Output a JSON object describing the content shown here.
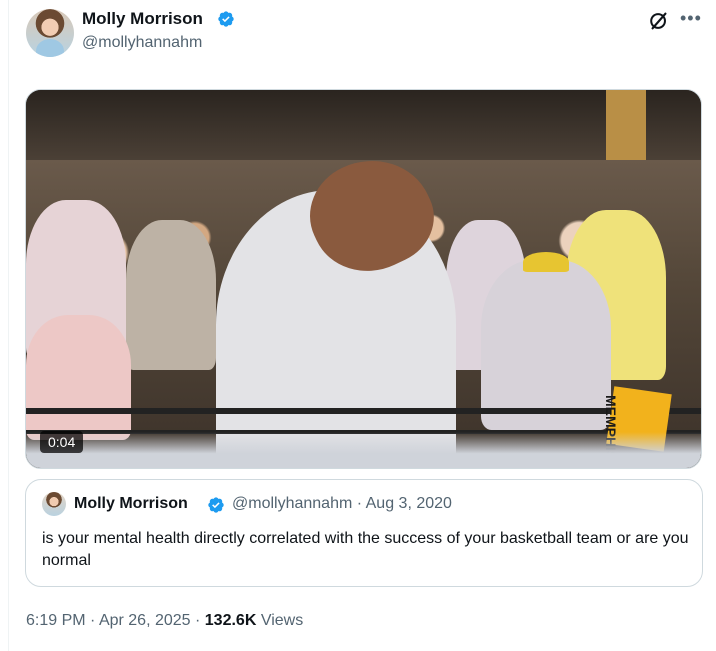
{
  "author": {
    "display_name": "Molly Morrison",
    "handle": "@mollyhannahm"
  },
  "media": {
    "duration": "0:04",
    "sign_text": "MEMPHIS"
  },
  "quoted_post": {
    "display_name": "Molly Morrison",
    "handle_and_date": "@mollyhannahm · Aug 3, 2020",
    "text": "is your mental health directly correlated with the success of your basketball team or are you normal"
  },
  "meta": {
    "time": "6:19 PM",
    "sep1": " · ",
    "date": "Apr 26, 2025",
    "sep2": " · ",
    "views_count": "132.6K",
    "views_label": " Views"
  },
  "icons": {
    "verified": "verified-badge-icon",
    "grok": "grok-icon",
    "more": "more-icon"
  },
  "colors": {
    "verified_blue": "#1d9bf0",
    "secondary_text": "#536471",
    "border": "#cfd9de"
  }
}
